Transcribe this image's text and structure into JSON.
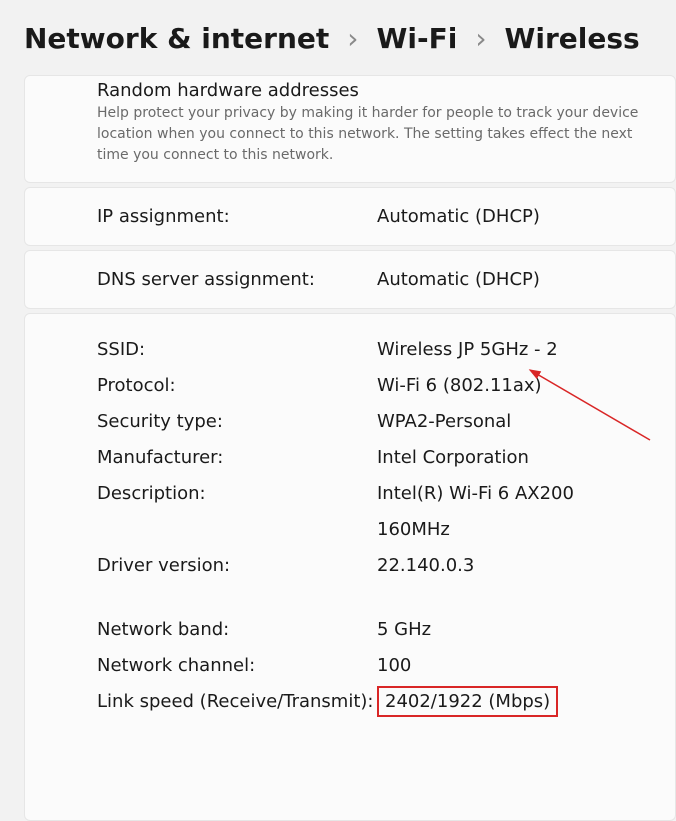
{
  "breadcrumb": {
    "level1": "Network & internet",
    "level2": "Wi-Fi",
    "level3": "Wireless"
  },
  "randomAddresses": {
    "title": "Random hardware addresses",
    "description": "Help protect your privacy by making it harder for people to track your device location when you connect to this network. The setting takes effect the next time you connect to this network."
  },
  "ipAssignment": {
    "label": "IP assignment:",
    "value": "Automatic (DHCP)"
  },
  "dnsAssignment": {
    "label": "DNS server assignment:",
    "value": "Automatic (DHCP)"
  },
  "details": {
    "ssid": {
      "label": "SSID:",
      "value": "Wireless JP 5GHz - 2"
    },
    "protocol": {
      "label": "Protocol:",
      "value": "Wi-Fi 6 (802.11ax)"
    },
    "securityType": {
      "label": "Security type:",
      "value": "WPA2-Personal"
    },
    "manufacturer": {
      "label": "Manufacturer:",
      "value": "Intel Corporation"
    },
    "description": {
      "label": "Description:",
      "value": "Intel(R) Wi-Fi 6 AX200 160MHz"
    },
    "driverVersion": {
      "label": "Driver version:",
      "value": "22.140.0.3"
    },
    "networkBand": {
      "label": "Network band:",
      "value": "5 GHz"
    },
    "networkChannel": {
      "label": "Network channel:",
      "value": "100"
    },
    "linkSpeed": {
      "label": "Link speed (Receive/Transmit):",
      "value": "2402/1922 (Mbps)"
    }
  }
}
